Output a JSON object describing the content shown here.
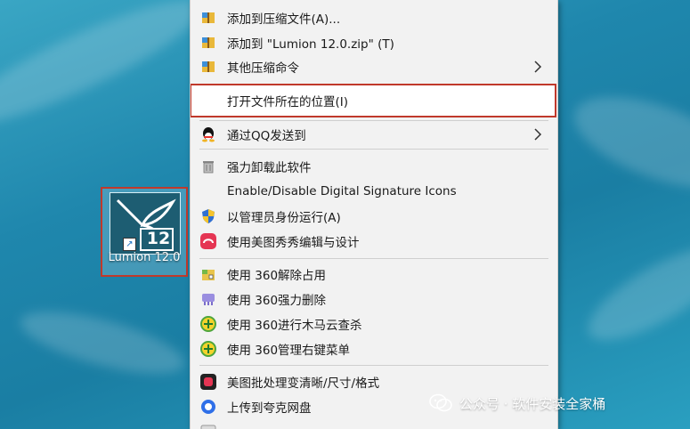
{
  "desktop_icon": {
    "label": "Lumion 12.0",
    "badge": "12"
  },
  "menu_items": [
    {
      "label": "添加到压缩文件(A)...",
      "icon": "archive-icon"
    },
    {
      "label": "添加到 \"Lumion 12.0.zip\" (T)",
      "icon": "archive-icon"
    },
    {
      "label": "其他压缩命令",
      "icon": "archive-icon",
      "submenu": true
    },
    {
      "label": "打开文件所在的位置(I)",
      "icon": "",
      "highlighted": true
    },
    {
      "label": "通过QQ发送到",
      "icon": "qq-icon",
      "submenu": true
    },
    {
      "label": "强力卸载此软件",
      "icon": "trash-icon"
    },
    {
      "label": "Enable/Disable Digital Signature Icons",
      "icon": ""
    },
    {
      "label": "以管理员身份运行(A)",
      "icon": "shield-icon"
    },
    {
      "label": "使用美图秀秀编辑与设计",
      "icon": "meitu-icon"
    },
    {
      "label": "使用 360解除占用",
      "icon": "unlock-icon"
    },
    {
      "label": "使用 360强力删除",
      "icon": "shred-icon"
    },
    {
      "label": "使用 360进行木马云查杀",
      "icon": "360-icon"
    },
    {
      "label": "使用 360管理右键菜单",
      "icon": "360-icon"
    },
    {
      "label": "美图批处理变清晰/尺寸/格式",
      "icon": "meitu-batch-icon"
    },
    {
      "label": "上传到夸克网盘",
      "icon": "quark-icon"
    }
  ],
  "watermark": {
    "text": "公众号 · 软件安装全家桶"
  },
  "colors": {
    "highlight_border": "#c0392b",
    "menu_bg": "#f2f2f2"
  }
}
